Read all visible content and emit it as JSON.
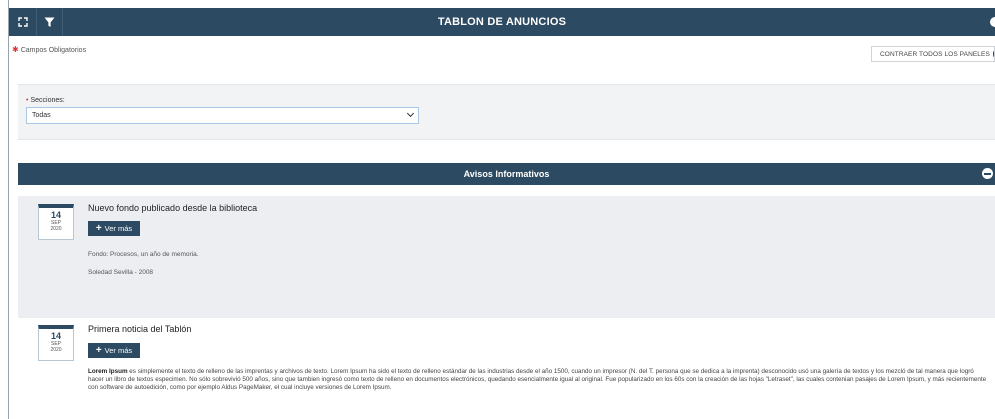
{
  "header": {
    "title": "TABLON DE ANUNCIOS",
    "expand_icon": "expand-icon",
    "filter_icon": "filter-icon"
  },
  "required_note": "Campos Obligatorios",
  "collapse_all_label": "CONTRAER TODOS LOS PANELES",
  "filters": {
    "sections_label": "Secciones:",
    "sections_value": "Todas"
  },
  "panel": {
    "title": "Avisos Informativos"
  },
  "notices": [
    {
      "day": "14",
      "month": "SEP",
      "year": "2020",
      "title": "Nuevo fondo publicado desde la biblioteca",
      "button": "Ver más",
      "meta1": "Fondo: Procesos, un año de memoria.",
      "meta2": "Soledad Sevilla - 2008"
    },
    {
      "day": "14",
      "month": "SEP",
      "year": "2020",
      "title": "Primera noticia del Tablón",
      "button": "Ver más",
      "lead": "Lorem Ipsum",
      "body": " es simplemente el texto de relleno de las imprentas y archivos de texto. Lorem Ipsum ha sido el texto de relleno estándar de las industrias desde el año 1500, cuando un impresor (N. del T. persona que se dedica a la imprenta) desconocido usó una galería de textos y los mezcló de tal manera que logró hacer un libro de textos especimen. No sólo sobrevivió 500 años, sino que tambien ingresó como texto de relleno en documentos electrónicos, quedando esencialmente igual al original. Fue popularizado en los 60s con la creación de las hojas \"Letraset\", las cuales contenian pasajes de Lorem Ipsum, y más recientemente con software de autoedición, como por ejemplo Aldus PageMaker, el cual incluye versiones de Lorem Ipsum."
    }
  ],
  "colors": {
    "primary": "#2c4a61",
    "required": "#dd3333"
  }
}
